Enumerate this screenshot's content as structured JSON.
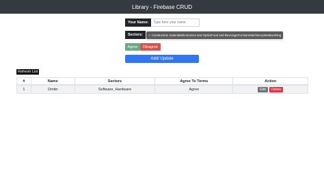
{
  "navbar": {
    "title": "Library - Firebase CRUD"
  },
  "form": {
    "name_label": "Your Name:",
    "name_placeholder": "Type here your name",
    "name_value": "",
    "sectors_label": "Sectors:",
    "sectors_selected_text": "Construction materialsElectronics and OpticsFood and BeverageFurnitureMachineryMetalworking",
    "agree_label": "Agree",
    "disagree_label": "Disagree",
    "submit_label": "Add/ Update"
  },
  "refresh_label": "Refresh List",
  "table": {
    "headers": [
      "#",
      "Name",
      "Sectors",
      "Agree To Terms",
      "Action"
    ],
    "rows": [
      {
        "num": "1",
        "name": "Dmitri",
        "sectors": "Software, Hardware",
        "agree": "Agree",
        "edit": "Edit",
        "delete": "Delete"
      }
    ]
  },
  "colors": {
    "navbar": "#343a40",
    "agree": "#6aa985",
    "disagree": "#d9534f",
    "primary": "#3476f0",
    "edit": "#6c757d",
    "delete": "#dc3545"
  }
}
